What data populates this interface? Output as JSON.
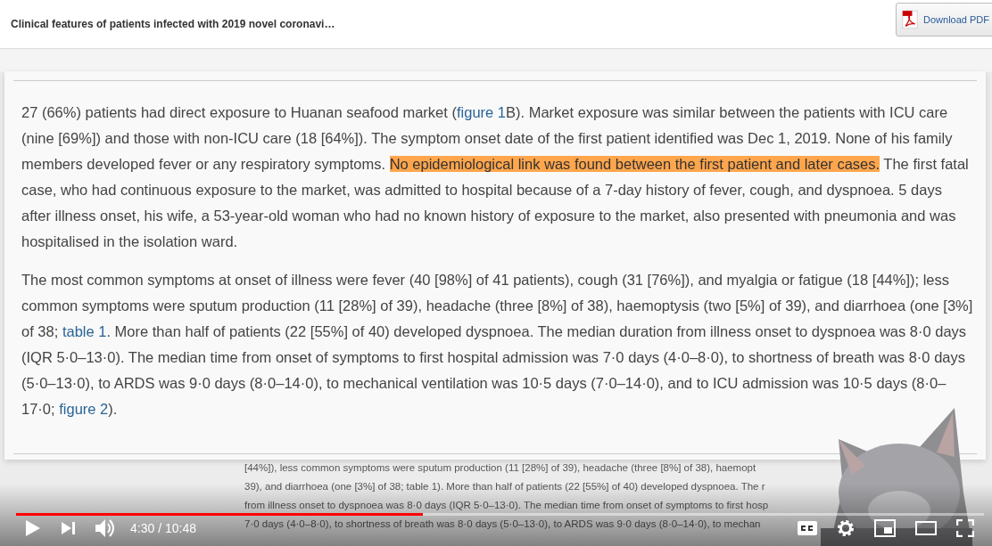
{
  "video": {
    "page": {
      "title": "Clinical features of patients infected with 2019 novel coronavi…",
      "download_button": "Download PDF",
      "background_lines": [
        "[44%]), less common symptoms were sputum production (11 [28%] of 39), headache (three [8%] of 38), haemopt",
        "39), and diarrhoea (one [3%] of 38; table 1). More than half of patients (22 [55%] of 40) developed dyspnoea. The r",
        "from illness onset to dyspnoea was 8·0 days (IQR 5·0–13·0). The median time from onset of symptoms to first hosp",
        "7·0 days (4·0–8·0), to shortness of breath was 8·0 days (5·0–13·0), to ARDS was 9·0 days (8·0–14·0), to mechan"
      ]
    },
    "zoomed_text": {
      "paragraphs": [
        [
          {
            "kind": "text",
            "text": "27 (66%) patients had direct exposure to Huanan seafood market ("
          },
          {
            "kind": "link",
            "text": "figure 1"
          },
          {
            "kind": "text",
            "text": "B). Market exposure was similar between the patients with ICU care (nine [69%]) and those with non-ICU care (18 [64%]). The symptom onset date of the first patient identified was Dec 1, 2019. None of his family members developed fever or any respiratory symptoms. "
          },
          {
            "kind": "highlight",
            "text": "No epidemiological link was found between the first patient and later cases."
          },
          {
            "kind": "text",
            "text": " The first fatal case, who had continuous exposure to the market, was admitted to hospital because of a 7-day history of fever, cough, and dyspnoea. 5 days after illness onset, his wife, a 53-year-old woman who had no known history of exposure to the market, also presented with pneumonia and was hospitalised in the isolation ward."
          }
        ],
        [
          {
            "kind": "text",
            "text": "The most common symptoms at onset of illness were fever (40 [98%] of 41 patients), cough (31 [76%]), and myalgia or fatigue (18 [44%]); less common symptoms were sputum production (11 [28%] of 39), headache (three [8%] of 38), haemoptysis (two [5%] of 39), and diarrhoea (one [3%] of 38; "
          },
          {
            "kind": "link",
            "text": "table 1"
          },
          {
            "kind": "text",
            "text": ". More than half of patients (22 [55%] of 40) developed dyspnoea. The median duration from illness onset to dyspnoea was 8·0 days (IQR 5·0–13·0). The median time from onset of symptoms to first hospital admission was 7·0 days (4·0–8·0), to shortness of breath was 8·0 days (5·0–13·0), to ARDS was 9·0 days (8·0–14·0), to mechanical ventilation was 10·5 days (7·0–14·0), and to ICU admission was 10·5 days (8·0–17·0; "
          },
          {
            "kind": "link",
            "text": "figure 2"
          },
          {
            "kind": "text",
            "text": ")."
          }
        ]
      ]
    }
  },
  "player": {
    "progress": {
      "level": 0.42
    },
    "time": "4:30 / 10:48"
  }
}
